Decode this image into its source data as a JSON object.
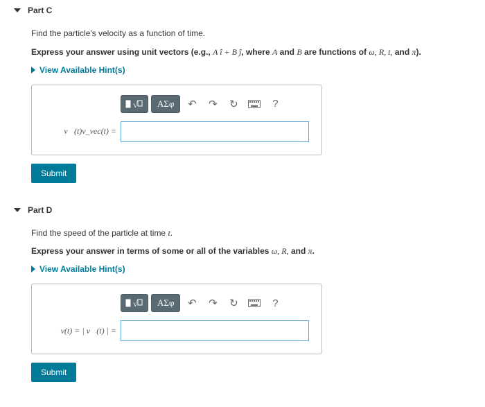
{
  "parts": [
    {
      "title": "Part C",
      "question": "Find the particle's velocity as a function of time.",
      "express_prefix": "Express your answer using unit vectors (e.g., ",
      "express_formula": "A î + B ĵ",
      "express_mid": ", where ",
      "express_vars1": "A",
      "express_and1": " and ",
      "express_vars2": "B",
      "express_suffix1": " are functions of ",
      "express_tail_vars": "ω, R, t,",
      "express_tail_and": " and ",
      "express_tail_last": "π",
      "express_close": ").",
      "hints": "View Available Hint(s)",
      "lhs": "v⃗(t)v_vec(t) =",
      "submit": "Submit"
    },
    {
      "title": "Part D",
      "question": "Find the speed of the particle at time t.",
      "express_prefix": "Express your answer in terms of some or all of the variables ",
      "express_tail_vars": "ω, R,",
      "express_tail_and": " and ",
      "express_tail_last": "π",
      "express_close": ".",
      "hints": "View Available Hint(s)",
      "lhs": "v(t) = | v⃗(t) |  =",
      "submit": "Submit"
    }
  ],
  "toolbar": {
    "greek": "ΑΣφ",
    "help": "?"
  }
}
